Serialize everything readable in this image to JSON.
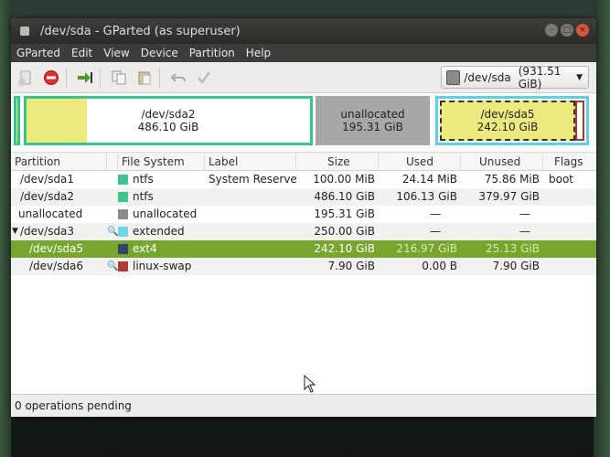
{
  "window": {
    "title": "/dev/sda - GParted (as superuser)"
  },
  "menu": [
    "GParted",
    "Edit",
    "View",
    "Device",
    "Partition",
    "Help"
  ],
  "device": {
    "label": "/dev/sda",
    "size": "(931.51 GiB)"
  },
  "graph": {
    "sda2": {
      "name": "/dev/sda2",
      "size": "486.10 GiB"
    },
    "unalloc": {
      "name": "unallocated",
      "size": "195.31 GiB"
    },
    "sda5": {
      "name": "/dev/sda5",
      "size": "242.10 GiB"
    }
  },
  "columns": [
    "Partition",
    "File System",
    "Label",
    "Size",
    "Used",
    "Unused",
    "Flags"
  ],
  "rows": [
    {
      "partition": "/dev/sda1",
      "fs": "ntfs",
      "label": "System Reserved",
      "size": "100.00 MiB",
      "used": "24.14 MiB",
      "unused": "75.86 MiB",
      "flags": "boot"
    },
    {
      "partition": "/dev/sda2",
      "fs": "ntfs",
      "label": "",
      "size": "486.10 GiB",
      "used": "106.13 GiB",
      "unused": "379.97 GiB",
      "flags": ""
    },
    {
      "partition": "unallocated",
      "fs": "unallocated",
      "label": "",
      "size": "195.31 GiB",
      "used": "—",
      "unused": "—",
      "flags": ""
    },
    {
      "partition": "/dev/sda3",
      "fs": "extended",
      "label": "",
      "size": "250.00 GiB",
      "used": "—",
      "unused": "—",
      "flags": ""
    },
    {
      "partition": "/dev/sda5",
      "fs": "ext4",
      "label": "",
      "size": "242.10 GiB",
      "used": "216.97 GiB",
      "unused": "25.13 GiB",
      "flags": ""
    },
    {
      "partition": "/dev/sda6",
      "fs": "linux-swap",
      "label": "",
      "size": "7.90 GiB",
      "used": "0.00 B",
      "unused": "7.90 GiB",
      "flags": ""
    }
  ],
  "colors": {
    "ntfs": "#3fc58c",
    "unallocated": "#8a8a8a",
    "extended": "#6fd5e6",
    "ext4": "#324468",
    "linux-swap": "#b53a30",
    "selection": "#77a52d"
  },
  "status": "0 operations pending"
}
